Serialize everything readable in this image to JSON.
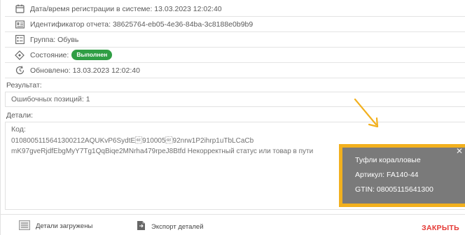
{
  "info": {
    "registration": "Дата/время регистрации в системе: 13.03.2023 12:02:40",
    "report_id": "Идентификатор отчета: 38625764-eb05-4e36-84ba-3c8188e0b9b9",
    "group": "Группа: Обувь",
    "state_label": "Состояние:",
    "state_badge": "Выполнен",
    "updated": "Обновлено: 13.03.2023 12:02:40"
  },
  "result": {
    "label": "Результат:",
    "errors": "Ошибочных позиций: 1"
  },
  "details": {
    "label": "Детали:",
    "code_label": "Код:",
    "code_line1": "0108005115641300212AQUKvP6SydtE\u001d910005\u001d92nrw1P2ihrp1uTbLCaCb",
    "code_line2": "mK97gveRjdfEbgMyY7Tg1QqBiqe2MNrha479rpeJ8Btfd Некорректный ст",
    "code_line2_tail": "атус или товар в пути"
  },
  "tooltip": {
    "name": "Туфли коралловые",
    "article": "Артикул: FA140-44",
    "gtin": "GTIN: 08005115641300",
    "close": "✕"
  },
  "footer": {
    "details_loaded": "Детали загружены",
    "export_details": "Экспорт деталей",
    "close": "ЗАКРЫТЬ"
  },
  "colors": {
    "badge": "#2f9e44",
    "highlight": "#f2b01e",
    "close": "#e53935"
  }
}
